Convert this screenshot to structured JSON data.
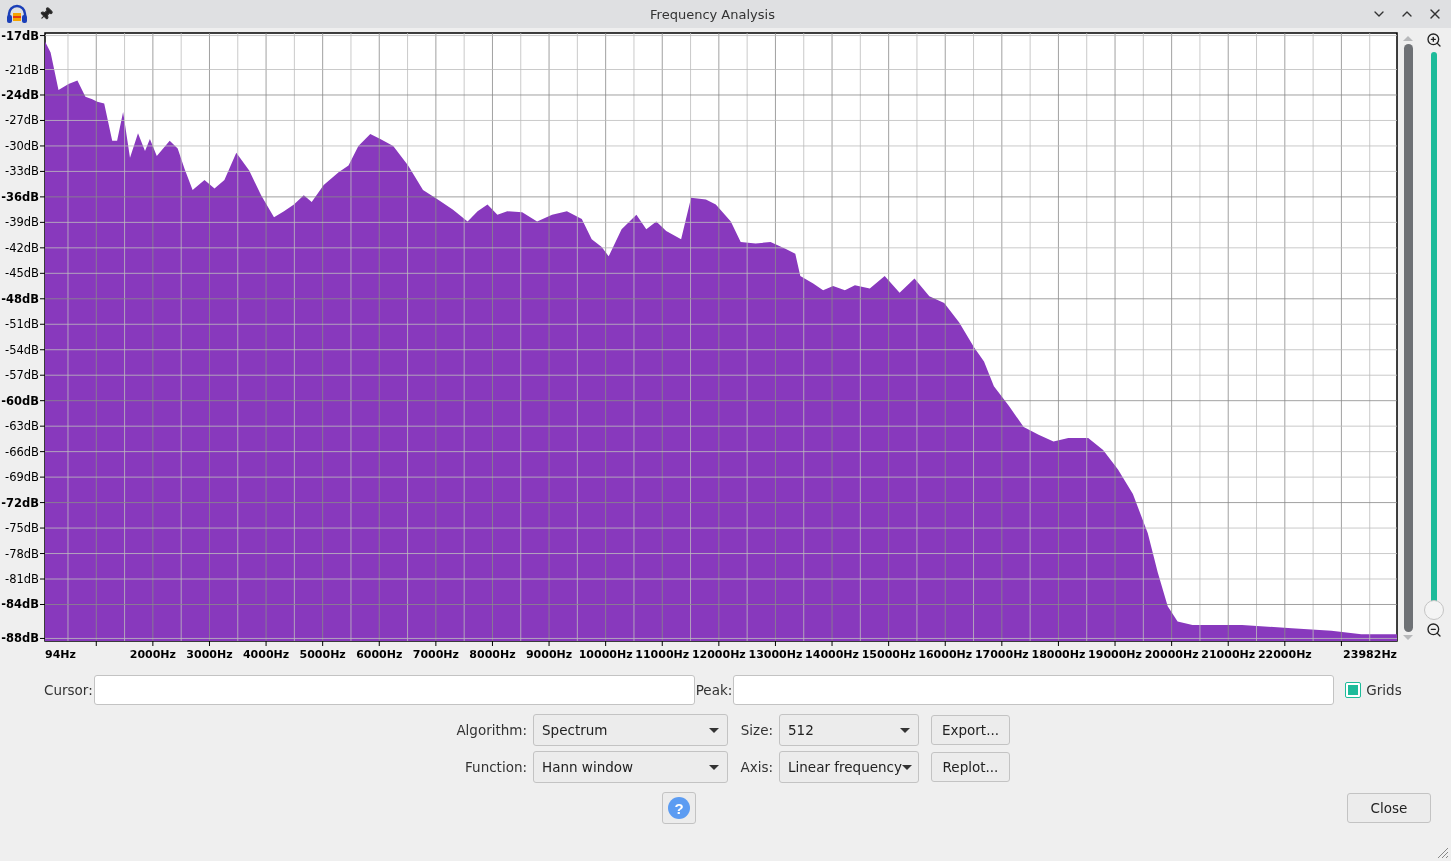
{
  "window": {
    "title": "Frequency Analysis"
  },
  "plot": {
    "chart_data": {
      "type": "area",
      "xlim": [
        94,
        23982
      ],
      "ylim": [
        -88.3,
        -16.7
      ],
      "grid": true,
      "xticks": [
        {
          "value": 94,
          "label": "94Hz"
        },
        {
          "value": 2000,
          "label": "2000Hz"
        },
        {
          "value": 3000,
          "label": "3000Hz"
        },
        {
          "value": 4000,
          "label": "4000Hz"
        },
        {
          "value": 5000,
          "label": "5000Hz"
        },
        {
          "value": 6000,
          "label": "6000Hz"
        },
        {
          "value": 7000,
          "label": "7000Hz"
        },
        {
          "value": 8000,
          "label": "8000Hz"
        },
        {
          "value": 9000,
          "label": "9000Hz"
        },
        {
          "value": 10000,
          "label": "10000Hz"
        },
        {
          "value": 11000,
          "label": "11000Hz"
        },
        {
          "value": 12000,
          "label": "12000Hz"
        },
        {
          "value": 13000,
          "label": "13000Hz"
        },
        {
          "value": 14000,
          "label": "14000Hz"
        },
        {
          "value": 15000,
          "label": "15000Hz"
        },
        {
          "value": 16000,
          "label": "16000Hz"
        },
        {
          "value": 17000,
          "label": "17000Hz"
        },
        {
          "value": 18000,
          "label": "18000Hz"
        },
        {
          "value": 19000,
          "label": "19000Hz"
        },
        {
          "value": 20000,
          "label": "20000Hz"
        },
        {
          "value": 21000,
          "label": "21000Hz"
        },
        {
          "value": 22000,
          "label": "22000Hz"
        },
        {
          "value": 23982,
          "label": "23982Hz"
        }
      ],
      "yticks": [
        {
          "value": -17,
          "label": "-17dB"
        },
        {
          "value": -21,
          "label": "-21dB"
        },
        {
          "value": -24,
          "label": "-24dB"
        },
        {
          "value": -27,
          "label": "-27dB"
        },
        {
          "value": -30,
          "label": "-30dB"
        },
        {
          "value": -33,
          "label": "-33dB"
        },
        {
          "value": -36,
          "label": "-36dB"
        },
        {
          "value": -39,
          "label": "-39dB"
        },
        {
          "value": -42,
          "label": "-42dB"
        },
        {
          "value": -45,
          "label": "-45dB"
        },
        {
          "value": -48,
          "label": "-48dB"
        },
        {
          "value": -51,
          "label": "-51dB"
        },
        {
          "value": -54,
          "label": "-54dB"
        },
        {
          "value": -57,
          "label": "-57dB"
        },
        {
          "value": -60,
          "label": "-60dB"
        },
        {
          "value": -63,
          "label": "-63dB"
        },
        {
          "value": -66,
          "label": "-66dB"
        },
        {
          "value": -69,
          "label": "-69dB"
        },
        {
          "value": -72,
          "label": "-72dB"
        },
        {
          "value": -75,
          "label": "-75dB"
        },
        {
          "value": -78,
          "label": "-78dB"
        },
        {
          "value": -81,
          "label": "-81dB"
        },
        {
          "value": -84,
          "label": "-84dB"
        },
        {
          "value": -88,
          "label": "-88dB"
        }
      ],
      "x": [
        94,
        193,
        333,
        509,
        667,
        807,
        930,
        1018,
        1140,
        1281,
        1368,
        1474,
        1596,
        1737,
        1860,
        1947,
        2070,
        2298,
        2439,
        2561,
        2702,
        2912,
        3088,
        3263,
        3474,
        3702,
        3912,
        4140,
        4316,
        4491,
        4667,
        4807,
        5018,
        5281,
        5456,
        5632,
        5842,
        6018,
        6246,
        6509,
        6772,
        7035,
        7298,
        7561,
        7737,
        7912,
        8088,
        8263,
        8526,
        8789,
        9053,
        9316,
        9579,
        9754,
        9930,
        10053,
        10281,
        10544,
        10719,
        10895,
        11070,
        11333,
        11509,
        11772,
        11947,
        12211,
        12386,
        12649,
        12912,
        13175,
        13351,
        13439,
        13667,
        13842,
        14018,
        14228,
        14404,
        14667,
        14930,
        15193,
        15456,
        15719,
        15982,
        16246,
        16509,
        16684,
        16860,
        17123,
        17386,
        17649,
        17912,
        18175,
        18526,
        18789,
        19053,
        19316,
        19579,
        19754,
        19930,
        20105,
        20368,
        21246,
        22123,
        22825,
        23351,
        23982
      ],
      "series": [
        {
          "color": "#8839bd",
          "values": [
            -17.7,
            -19,
            -23.4,
            -22.7,
            -22.3,
            -24.2,
            -24.5,
            -24.8,
            -25,
            -29.4,
            -29.4,
            -26,
            -31.4,
            -28.5,
            -30.6,
            -29.2,
            -31.2,
            -29.4,
            -30.3,
            -32.7,
            -35.2,
            -34,
            -35,
            -34,
            -30.8,
            -32.9,
            -35.8,
            -38.4,
            -37.7,
            -36.9,
            -35.8,
            -36.6,
            -34.6,
            -33.1,
            -32.3,
            -30,
            -28.6,
            -29.2,
            -30,
            -32.3,
            -35.2,
            -36.3,
            -37.5,
            -38.9,
            -37.7,
            -36.9,
            -38.1,
            -37.7,
            -37.8,
            -38.9,
            -38.1,
            -37.7,
            -38.6,
            -41,
            -41.9,
            -43,
            -39.8,
            -38.1,
            -39.8,
            -38.9,
            -40,
            -41,
            -36.1,
            -36.3,
            -36.9,
            -38.9,
            -41.3,
            -41.5,
            -41.3,
            -42.1,
            -42.7,
            -45.3,
            -46.2,
            -47,
            -46.5,
            -47,
            -46.4,
            -46.8,
            -45.3,
            -47.3,
            -45.6,
            -47.7,
            -48.5,
            -50.8,
            -53.7,
            -55.4,
            -58.3,
            -60.6,
            -63.1,
            -64,
            -64.8,
            -64.4,
            -64.4,
            -65.8,
            -68.1,
            -71,
            -75.6,
            -80.2,
            -84.2,
            -86,
            -86.4,
            -86.4,
            -86.8,
            -87.1,
            -87.5,
            -87.5
          ]
        }
      ]
    }
  },
  "zoom_slider": {
    "level": 0
  },
  "cursor": {
    "label": "Cursor:"
  },
  "peak": {
    "label": "Peak:"
  },
  "grids": {
    "label": "Grids",
    "checked": true
  },
  "selects": [
    {
      "label": "Algorithm:",
      "value": "Spectrum"
    },
    {
      "label": "Size:",
      "value": "512"
    },
    {
      "label": "Function:",
      "value": "Hann window"
    },
    {
      "label": "Axis:",
      "value": "Linear frequency"
    }
  ],
  "side_buttons": [
    "Export...",
    "Replot..."
  ],
  "help_button": {
    "label": "?"
  },
  "close_button": {
    "label": "Close"
  }
}
